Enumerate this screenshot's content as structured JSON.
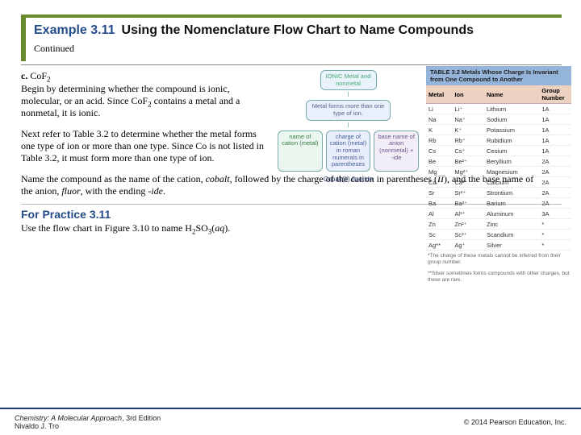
{
  "header": {
    "example_label": "Example 3.11",
    "title": "Using the Nomenclature Flow Chart to Name Compounds",
    "continued": "Continued"
  },
  "part_c": {
    "label": "c.",
    "formula_prefix": "Co",
    "formula_anion": "F",
    "formula_sub": "2",
    "p1a": "Begin by determining whether the compound is ionic, molecular, or an acid. Since Co",
    "p1b": " contains a metal and a nonmetal, it is ionic.",
    "p2": "Next refer to Table 3.2 to determine whether the metal forms one type of ion or more than one type. Since Co is not listed in Table 3.2, it must form more than one type of ion.",
    "p3a": "Name the compound as the name of the cation, ",
    "p3b": "cobalt",
    "p3c": ", followed by the charge of the cation in parentheses (",
    "p3d": "II",
    "p3e": "), and the base name of the anion, ",
    "p3f": "fluor",
    "p3g": ", with the ending -",
    "p3h": "ide",
    "p3i": "."
  },
  "flowchart": {
    "top": "IONIC\nMetal and nonmetal",
    "mid": "Metal forms more than one type of ion.",
    "left": "name of cation (metal)",
    "center": "charge of cation (metal) in roman numerals in parentheses",
    "right": "base name of anion (nonmetal) + -ide",
    "result": "Cobalt(II) fluoride"
  },
  "table": {
    "title": "TABLE 3.2  Metals Whose Charge Is Invariant from One Compound to Another",
    "headers": [
      "Metal",
      "Ion",
      "Name",
      "Group Number"
    ],
    "rows": [
      [
        "Li",
        "Li⁺",
        "Lithium",
        "1A"
      ],
      [
        "Na",
        "Na⁺",
        "Sodium",
        "1A"
      ],
      [
        "K",
        "K⁺",
        "Potassium",
        "1A"
      ],
      [
        "Rb",
        "Rb⁺",
        "Rubidium",
        "1A"
      ],
      [
        "Cs",
        "Cs⁺",
        "Cesium",
        "1A"
      ],
      [
        "Be",
        "Be²⁺",
        "Beryllium",
        "2A"
      ],
      [
        "Mg",
        "Mg²⁺",
        "Magnesium",
        "2A"
      ],
      [
        "Ca",
        "Ca²⁺",
        "Calcium",
        "2A"
      ],
      [
        "Sr",
        "Sr²⁺",
        "Strontium",
        "2A"
      ],
      [
        "Ba",
        "Ba²⁺",
        "Barium",
        "2A"
      ],
      [
        "Al",
        "Al³⁺",
        "Aluminum",
        "3A"
      ],
      [
        "Zn",
        "Zn²⁺",
        "Zinc",
        "*"
      ],
      [
        "Sc",
        "Sc³⁺",
        "Scandium",
        "*"
      ],
      [
        "Ag**",
        "Ag⁺",
        "Silver",
        "*"
      ]
    ],
    "foot1": "*The charge of these metals cannot be inferred from their group number.",
    "foot2": "**Silver sometimes forms compounds with other charges, but these are rare."
  },
  "practice": {
    "heading": "For Practice 3.11",
    "text_a": "Use the flow chart in Figure 3.10 to name H",
    "sub1": "2",
    "text_b": "SO",
    "sub2": "3",
    "text_c": "(",
    "aq": "aq",
    "text_d": ")."
  },
  "footer": {
    "book": "Chemistry: A Molecular Approach",
    "edition": ", 3rd Edition",
    "author": "Nivaldo J. Tro",
    "copyright": "© 2014 Pearson Education, Inc."
  }
}
